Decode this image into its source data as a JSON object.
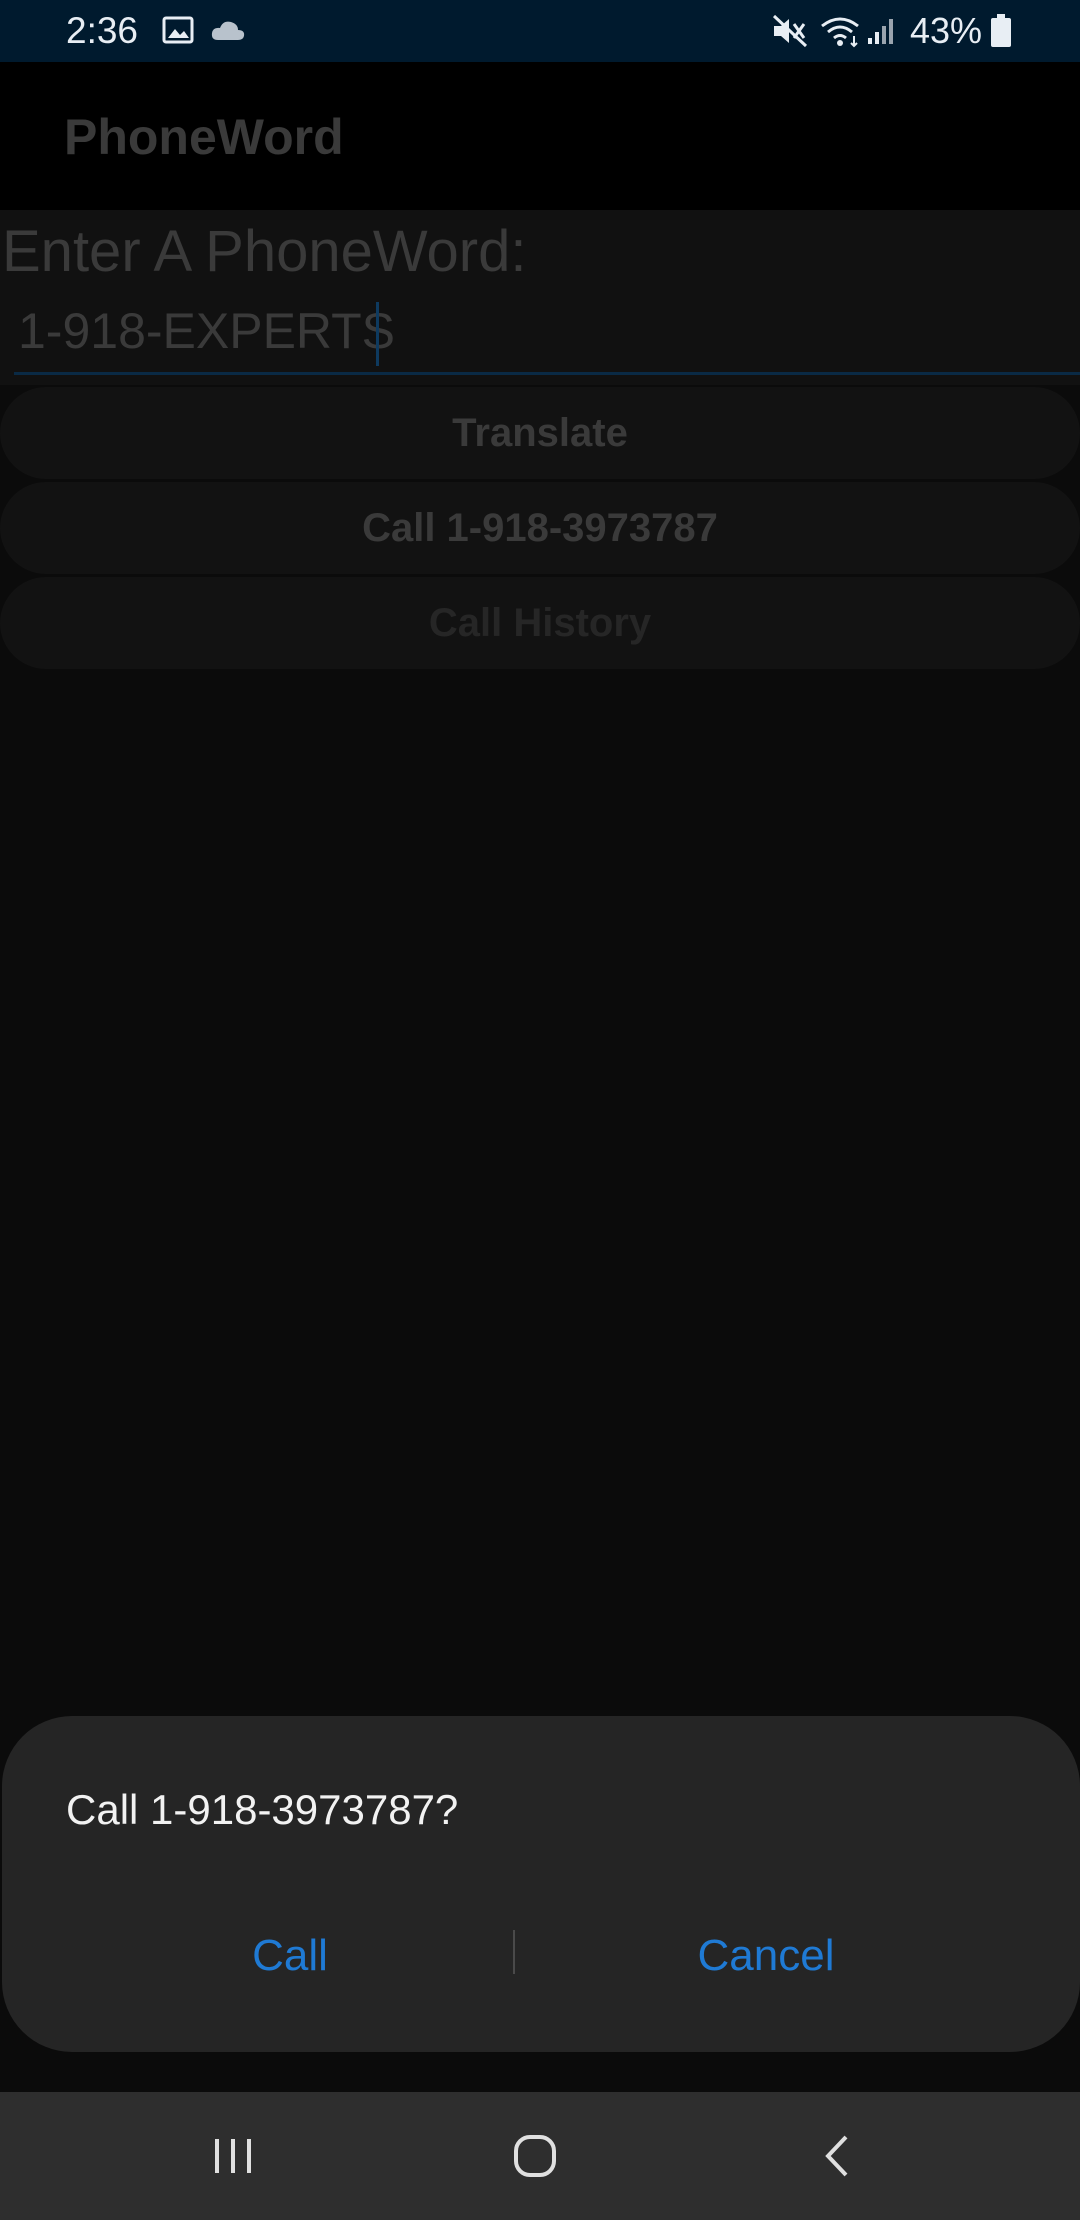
{
  "status_bar": {
    "time": "2:36",
    "battery_percent": "43%",
    "icons": [
      "image-icon",
      "cloud-icon",
      "mute-icon",
      "wifi-icon",
      "signal-icon",
      "battery-icon"
    ]
  },
  "app": {
    "title": "PhoneWord",
    "prompt_label": "Enter A PhoneWord:",
    "entry_value": "1-918-EXPERTS",
    "buttons": {
      "translate": "Translate",
      "call": "Call 1-918-3973787",
      "call_history": "Call History"
    }
  },
  "dialog": {
    "message": "Call 1-918-3973787?",
    "call_label": "Call",
    "cancel_label": "Cancel",
    "accent_color": "#1f7ad4"
  },
  "nav_bar": {
    "icons": [
      "recents-icon",
      "home-icon",
      "back-icon"
    ]
  }
}
